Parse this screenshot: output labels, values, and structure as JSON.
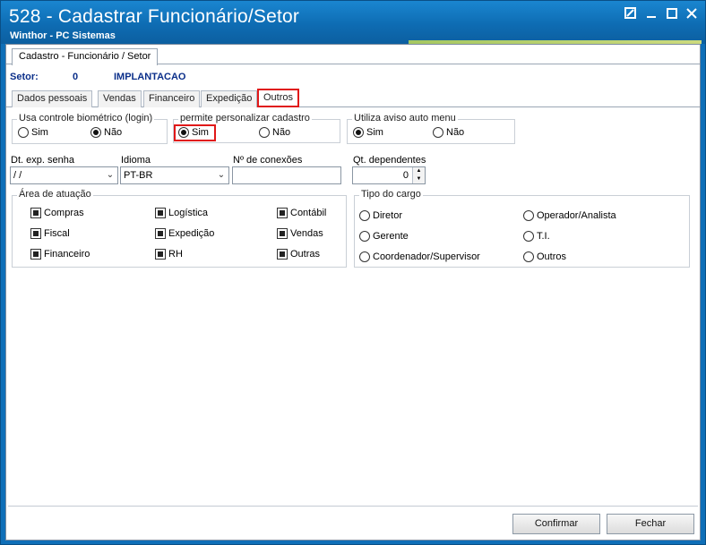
{
  "window": {
    "title": "528 - Cadastrar Funcionário/Setor",
    "subtitle": "Winthor - PC Sistemas",
    "controls": [
      "restore-icon",
      "minimize-icon",
      "maximize-icon",
      "close-icon"
    ]
  },
  "main_tab": "Cadastro - Funcionário / Setor",
  "setor": {
    "label": "Setor:",
    "code": "0",
    "name": "IMPLANTACAO"
  },
  "tabs": [
    "Dados pessoais",
    "Vendas",
    "Financeiro",
    "Expedição",
    "Outros"
  ],
  "active_tab": "Outros",
  "biometrico": {
    "title": "Usa controle biométrico (login)",
    "options": [
      "Sim",
      "Não"
    ],
    "selected": "Não"
  },
  "personalizar": {
    "title": "permite personalizar cadastro",
    "options": [
      "Sim",
      "Não"
    ],
    "selected": "Sim"
  },
  "aviso": {
    "title": "Utiliza aviso auto menu",
    "options": [
      "Sim",
      "Não"
    ],
    "selected": "Sim"
  },
  "fields": {
    "dt_exp_label": "Dt. exp. senha",
    "dt_exp_value": " / /",
    "idioma_label": "Idioma",
    "idioma_value": "PT-BR",
    "conexoes_label": "Nº de conexões",
    "conexoes_value": "",
    "dependentes_label": "Qt. dependentes",
    "dependentes_value": "0"
  },
  "area": {
    "title": "Área de atuação",
    "items": [
      {
        "label": "Compras",
        "checked": true
      },
      {
        "label": "Logística",
        "checked": true
      },
      {
        "label": "Contábil",
        "checked": true
      },
      {
        "label": "Fiscal",
        "checked": true
      },
      {
        "label": "Expedição",
        "checked": true
      },
      {
        "label": "Vendas",
        "checked": true
      },
      {
        "label": "Financeiro",
        "checked": true
      },
      {
        "label": "RH",
        "checked": true
      },
      {
        "label": "Outras",
        "checked": true
      }
    ]
  },
  "cargo": {
    "title": "Tipo do cargo",
    "options": [
      "Diretor",
      "Operador/Analista",
      "Gerente",
      "T.I.",
      "Coordenador/Supervisor",
      "Outros"
    ],
    "selected": ""
  },
  "buttons": {
    "confirmar": "Confirmar",
    "fechar": "Fechar"
  },
  "colors": {
    "titlebar": "#0e6cb3",
    "highlight": "#e01818",
    "setor_text": "#0b2f8a"
  }
}
